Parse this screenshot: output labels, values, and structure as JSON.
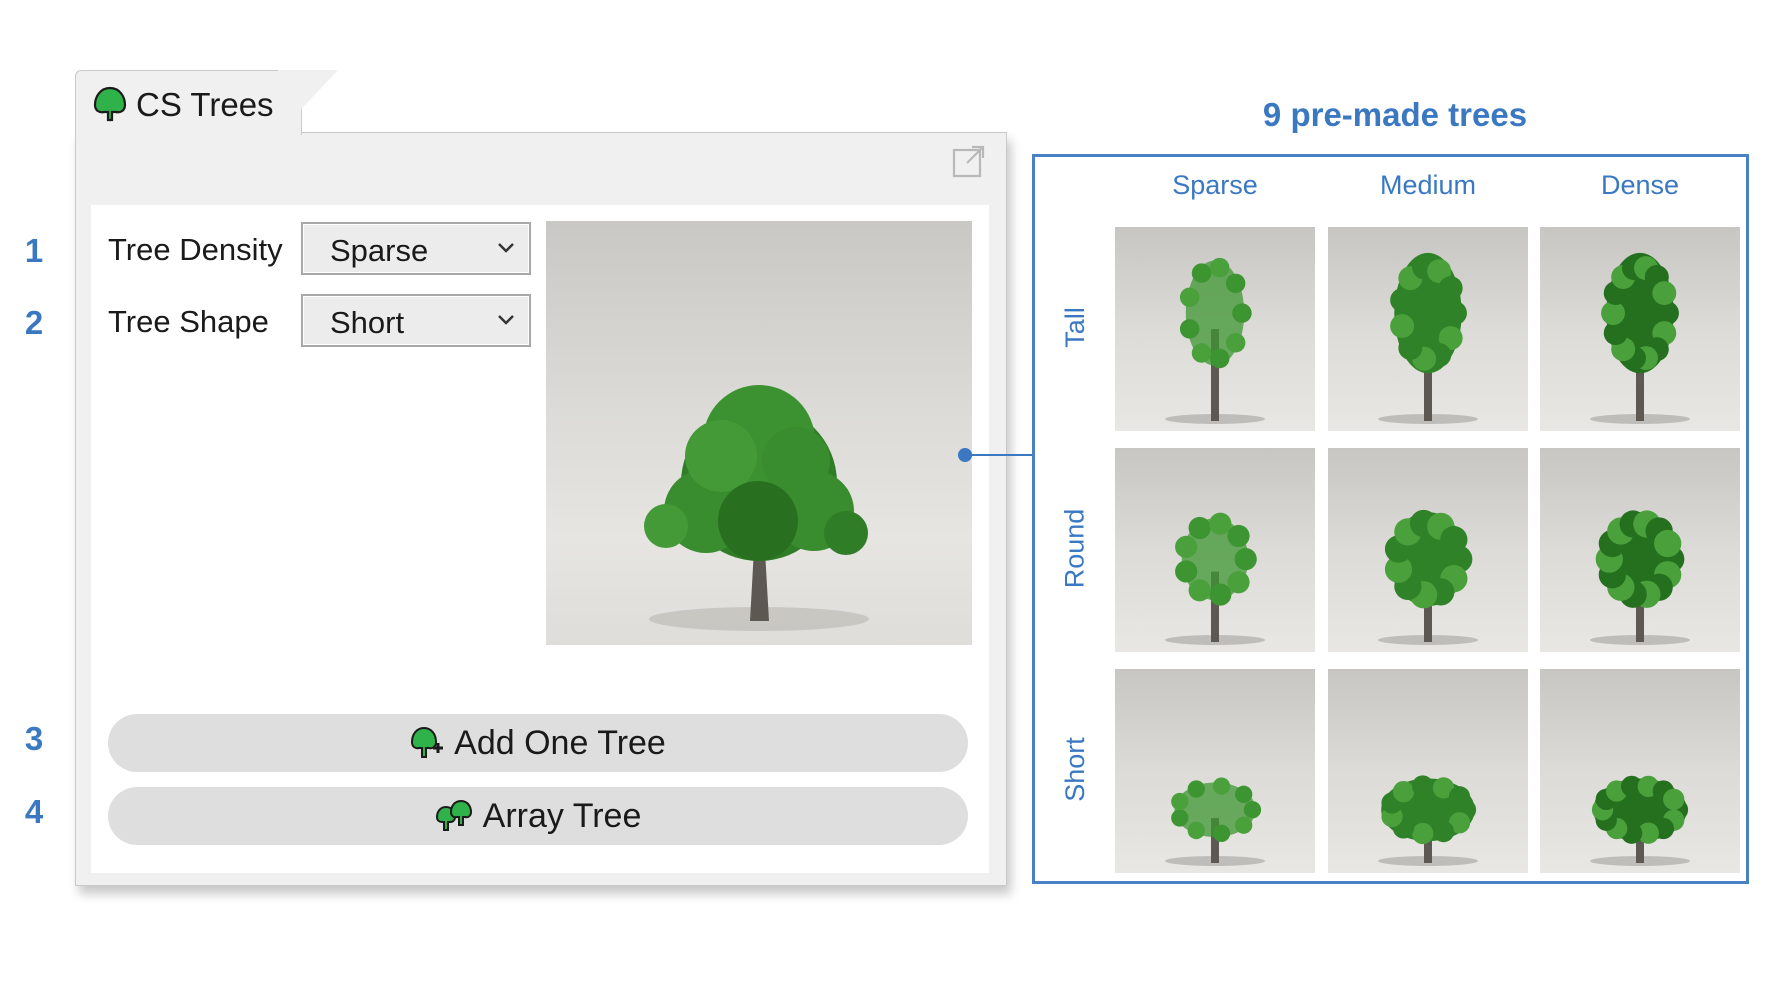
{
  "steps": [
    "1",
    "2",
    "3",
    "4"
  ],
  "panel": {
    "title": "CS Trees",
    "title_icon": "tree-icon",
    "popout_icon": "popout-icon",
    "density": {
      "label": "Tree Density",
      "value": "Sparse"
    },
    "shape": {
      "label": "Tree Shape",
      "value": "Short"
    },
    "add_button": {
      "label": "Add One Tree",
      "icon": "add-tree-icon"
    },
    "array_button": {
      "label": "Array Tree",
      "icon": "array-tree-icon"
    }
  },
  "grid": {
    "title": "9 pre-made trees",
    "columns": [
      "Sparse",
      "Medium",
      "Dense"
    ],
    "rows": [
      "Tall",
      "Round",
      "Short"
    ]
  },
  "colors": {
    "accent_blue": "#3a78c2",
    "foliage_green": "#2f7d27",
    "icon_green": "#2fb24a"
  }
}
